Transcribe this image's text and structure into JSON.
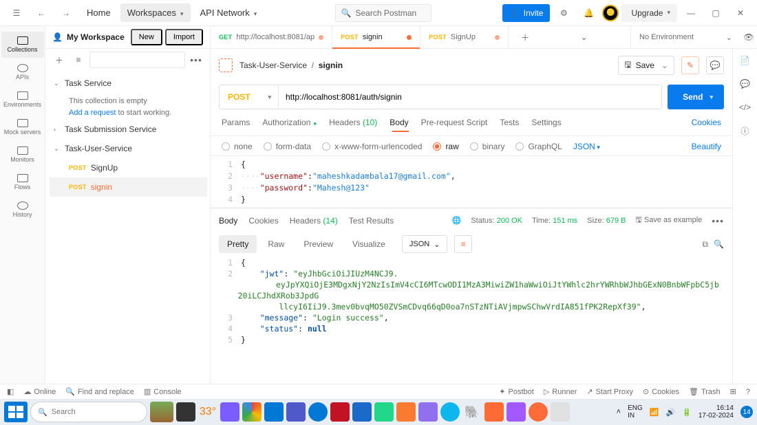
{
  "top": {
    "home": "Home",
    "workspaces": "Workspaces",
    "api_network": "API Network",
    "search_placeholder": "Search Postman",
    "invite": "Invite",
    "upgrade": "Upgrade"
  },
  "workspace": {
    "title": "My Workspace",
    "new": "New",
    "import": "Import"
  },
  "rail": {
    "collections": "Collections",
    "apis": "APIs",
    "environments": "Environments",
    "mock_servers": "Mock servers",
    "monitors": "Monitors",
    "flows": "Flows",
    "history": "History"
  },
  "tree": {
    "task_service": "Task Service",
    "empty_msg": "This collection is empty",
    "add_request": "Add a request",
    "empty_suffix": " to start working.",
    "task_submission": "Task Submission Service",
    "task_user": "Task-User-Service",
    "signup": "SignUp",
    "signin": "signin"
  },
  "tabs": [
    {
      "method": "GET",
      "label": "http://localhost:8081/ap"
    },
    {
      "method": "POST",
      "label": "signin"
    },
    {
      "method": "POST",
      "label": "SignUp"
    }
  ],
  "env": {
    "selected": "No Environment"
  },
  "breadcrumb": {
    "parent": "Task-User-Service",
    "leaf": "signin"
  },
  "save": "Save",
  "request": {
    "method": "POST",
    "url": "http://localhost:8081/auth/signin",
    "send": "Send"
  },
  "reqTabs": {
    "params": "Params",
    "auth": "Authorization",
    "headers": "Headers",
    "headers_count": "(10)",
    "body": "Body",
    "pre": "Pre-request Script",
    "tests": "Tests",
    "settings": "Settings",
    "cookies": "Cookies"
  },
  "bodyOpts": {
    "none": "none",
    "form": "form-data",
    "xwww": "x-www-form-urlencoded",
    "raw": "raw",
    "binary": "binary",
    "graphql": "GraphQL",
    "json": "JSON",
    "beautify": "Beautify"
  },
  "reqBody": {
    "username_field": "\"username\"",
    "username_val": "\"maheshkadambala17@gmail.com\"",
    "password_field": "\"password\"",
    "password_val": "\"Mahesh@123\""
  },
  "respTabs": {
    "body": "Body",
    "cookies": "Cookies",
    "headers": "Headers",
    "headers_ct": "(14)",
    "tests": "Test Results"
  },
  "respMeta": {
    "globe": "🌐",
    "status_l": "Status:",
    "status": "200 OK",
    "time_l": "Time:",
    "time": "151 ms",
    "size_l": "Size:",
    "size": "679 B",
    "save_ex": "Save as example"
  },
  "respMode": {
    "pretty": "Pretty",
    "raw": "Raw",
    "preview": "Preview",
    "visualize": "Visualize",
    "json": "JSON"
  },
  "respBody": {
    "jwt_k": "\"jwt\"",
    "jwt_v1": "\"eyJhbGciOiJIUzM4NCJ9.",
    "jwt_v2": "eyJpYXQiOjE3MDgxNjY2NzIsImV4cCI6MTcwODI1MzA3MiwiZW1haWwiOiJtYWhlc2hrYWRhbWJhbGExN0BnbWFpbC5jb20iLCJhdXRob3JpdG",
    "jwt_v3": "llcyI6IiJ9.3mev0bvqMO50ZVSmCDvq66qD0oa7nSTzNTiAVjmpwSChwVrdIA851fPK2RepXf39\"",
    "msg_k": "\"message\"",
    "msg_v": "\"Login success\"",
    "status_k": "\"status\"",
    "status_v": "null"
  },
  "bottom": {
    "online": "Online",
    "find": "Find and replace",
    "console": "Console",
    "postbot": "Postbot",
    "runner": "Runner",
    "proxy": "Start Proxy",
    "cookies": "Cookies",
    "trash": "Trash"
  },
  "taskbar": {
    "search": "Search",
    "lang1": "ENG",
    "lang2": "IN",
    "time": "16:14",
    "date": "17-02-2024",
    "notif": "14"
  }
}
